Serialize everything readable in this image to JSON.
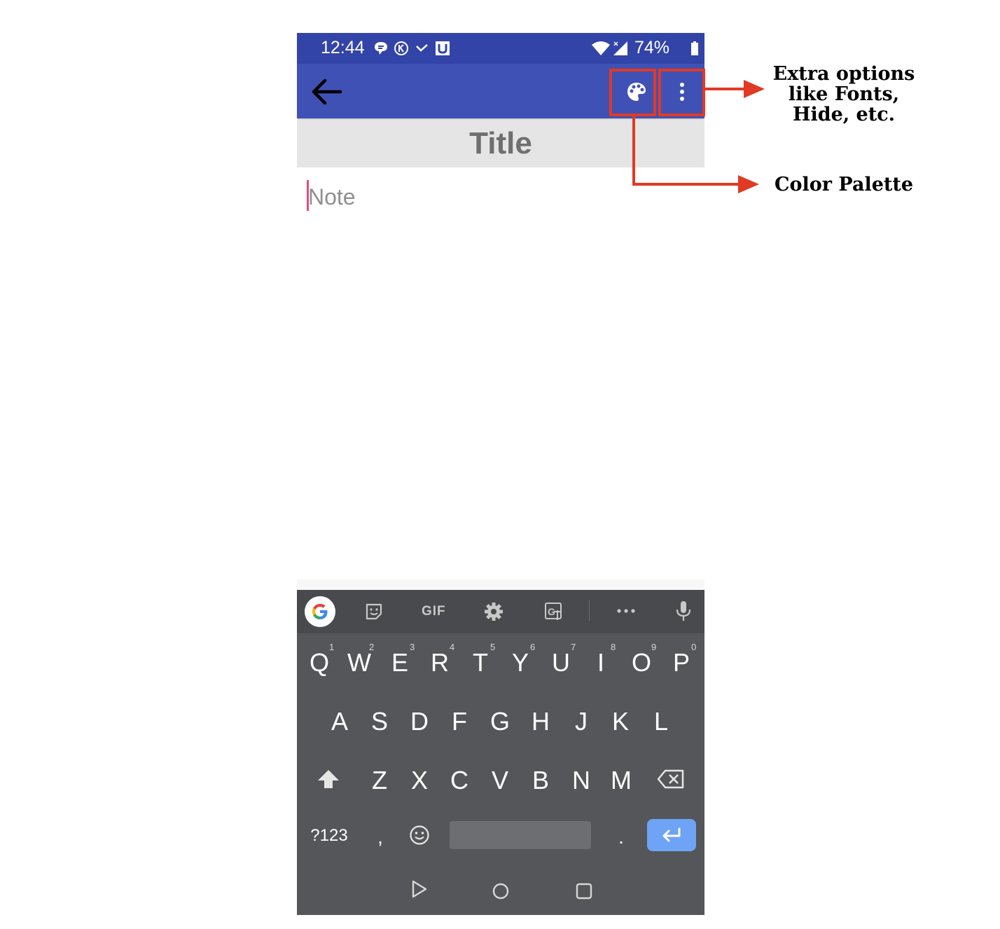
{
  "status_bar": {
    "time": "12:44",
    "battery": "74%",
    "icons": [
      "chat-bubble-icon",
      "k-circle-icon",
      "missed-call-icon",
      "u-box-icon",
      "wifi-icon",
      "signal-icon",
      "battery-icon"
    ]
  },
  "app_bar": {
    "back_icon": "arrow-left-icon",
    "palette_icon": "palette-icon",
    "more_icon": "more-vertical-icon"
  },
  "editor": {
    "title_placeholder": "Title",
    "note_placeholder": "Note"
  },
  "keyboard": {
    "toolbar": {
      "gif_label": "GIF",
      "icons": [
        "google-icon",
        "sticker-icon",
        "gif-icon",
        "settings-icon",
        "translate-icon",
        "more-horizontal-icon",
        "microphone-icon"
      ]
    },
    "row1": [
      "Q",
      "W",
      "E",
      "R",
      "T",
      "Y",
      "U",
      "I",
      "O",
      "P"
    ],
    "row1_hints": [
      "1",
      "2",
      "3",
      "4",
      "5",
      "6",
      "7",
      "8",
      "9",
      "0"
    ],
    "row2": [
      "A",
      "S",
      "D",
      "F",
      "G",
      "H",
      "J",
      "K",
      "L"
    ],
    "row3": [
      "Z",
      "X",
      "C",
      "V",
      "B",
      "N",
      "M"
    ],
    "symbols_label": "?123",
    "comma": ",",
    "period": "."
  },
  "annotations": {
    "more_options_label": "Extra options like Fonts, Hide, etc.",
    "palette_label": "Color Palette",
    "color": "#e03a24"
  },
  "colors": {
    "status_bar": "#3244a8",
    "app_bar": "#3f51b5",
    "keyboard": "#545659",
    "enter_key": "#6ea3f5"
  }
}
